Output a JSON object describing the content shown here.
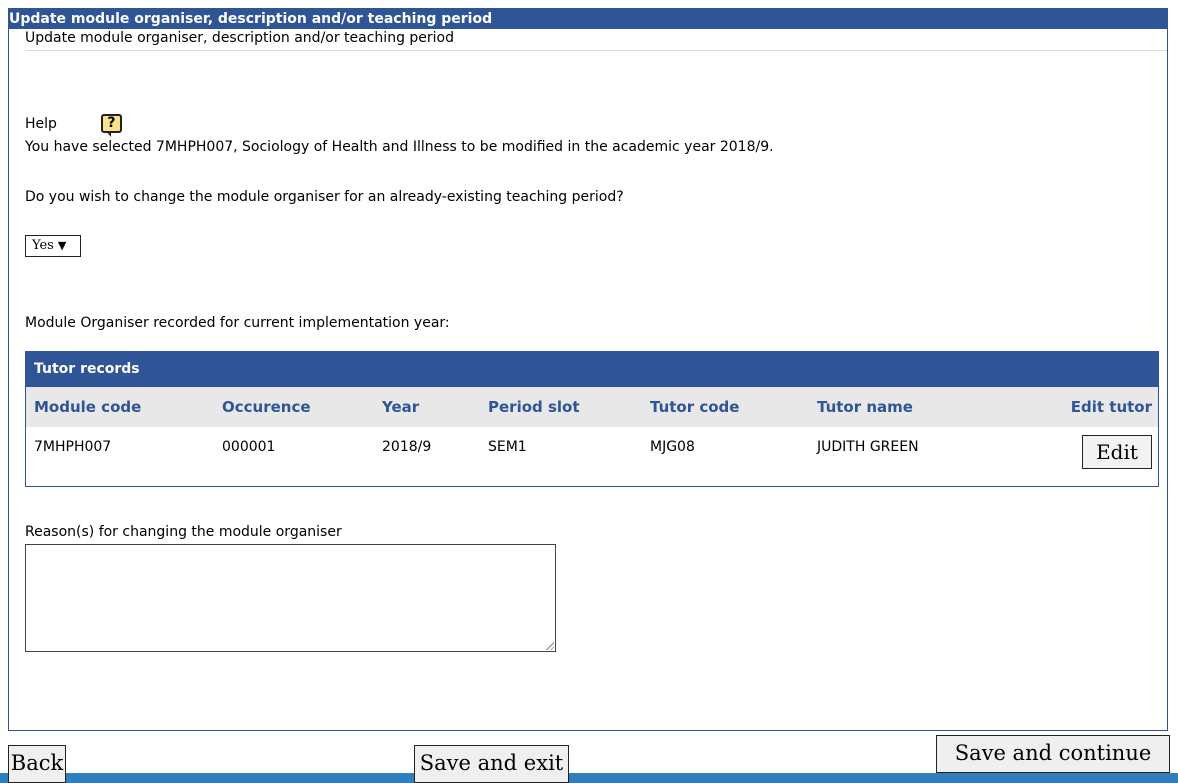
{
  "panel": {
    "header_title": "Update module organiser, description and/or teaching period",
    "subtitle": "Update module organiser, description and/or teaching period"
  },
  "help": {
    "label": "Help",
    "icon": "help-icon",
    "icon_glyph": "?"
  },
  "content": {
    "selection_text": "You have selected 7MHPH007, Sociology of Health and Illness to be modified in the academic year 2018/9.",
    "question": "Do you wish to change the module organiser for an already-existing teaching period?",
    "select_value": "Yes",
    "organiser_text": "Module Organiser recorded for current implementation year:",
    "reason_label": "Reason(s) for changing the module organiser",
    "reason_value": ""
  },
  "table": {
    "title": "Tutor records",
    "headers": [
      "Module code",
      "Occurence",
      "Year",
      "Period slot",
      "Tutor code",
      "Tutor name",
      "Edit tutor"
    ],
    "rows": [
      {
        "module_code": "7MHPH007",
        "occurence": "000001",
        "year": "2018/9",
        "period_slot": "SEM1",
        "tutor_code": "MJG08",
        "tutor_name": "JUDITH GREEN",
        "edit_label": "Edit"
      }
    ]
  },
  "buttons": {
    "back": "Back",
    "save_exit": "Save and exit",
    "save_continue": "Save and continue"
  },
  "colors": {
    "header_blue": "#2f5597",
    "table_header_bg": "#e8e8e8",
    "bottom_bar": "#2f7fbf"
  }
}
